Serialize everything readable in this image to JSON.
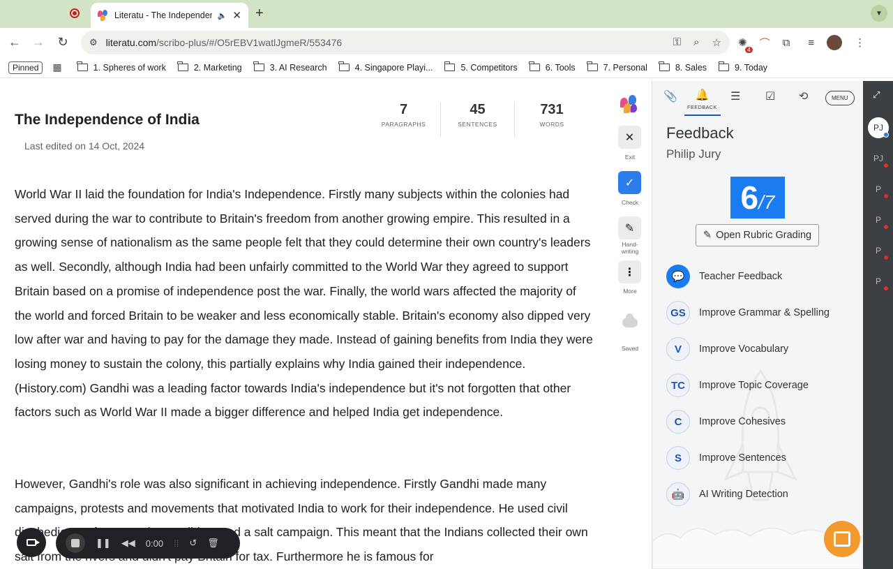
{
  "browser": {
    "tab_title": "Literatu - The Independen",
    "url_host": "literatu.com",
    "url_path": "/scribo-plus/#/O5rEBV1watlJgmeR/553476",
    "extension_badge": "4",
    "pinned_label": "Pinned",
    "bookmarks": [
      "1. Spheres of work",
      "2. Marketing",
      "3. AI Research",
      "4. Singapore Playi...",
      "5. Competitors",
      "6. Tools",
      "7. Personal",
      "8. Sales",
      "9. Today"
    ]
  },
  "document": {
    "title": "The Independence of India",
    "last_edited": "Last edited on 14 Oct, 2024",
    "stats": [
      {
        "value": "7",
        "label": "PARAGRAPHS"
      },
      {
        "value": "45",
        "label": "SENTENCES"
      },
      {
        "value": "731",
        "label": "WORDS"
      }
    ],
    "paragraph_1": "World War II laid the foundation for India's Independence. Firstly many subjects within the colonies had served during the war to contribute to Britain's freedom from another growing empire. This resulted in a growing sense of nationalism as the same people felt that they could determine their own country's leaders as well. Secondly, although India had been unfairly committed to the World War they agreed to support Britain based on a promise of independence post the war. Finally, the world wars affected the majority of the world and forced Britain to be weaker and less economically stable. Britain's economy also dipped very low after war and having to pay for the damage they made. Instead of gaining benefits from India they were losing money to sustain the colony, this partially explains why India gained their independence.(History.com) Gandhi was a leading factor towards India's independence but it's not forgotten that other factors such as World War II made a bigger difference and helped India get independence.",
    "paragraph_2": "However,  Gandhi's role was also significant in achieving independence. Firstly Gandhi made many campaigns, protests and movements that motivated India to work for their independence. He used civil disobedience, for example Gandhi started a salt campaign. This meant that the Indians collected their own salt from the rivers and didn't pay Britain for tax. Furthermore he is famous for"
  },
  "tools": {
    "exit": "Exit",
    "check": "Check",
    "handwriting": "Hand-\nwriting",
    "more": "More",
    "saved": "Saved"
  },
  "panel": {
    "tab_feedback_label": "FEEDBACK",
    "menu_label": "MENU",
    "heading": "Feedback",
    "student_name": "Philip Jury",
    "score": "6",
    "score_max": "/7",
    "rubric_button": "Open Rubric Grading",
    "items": [
      {
        "badge": "",
        "label": "Teacher Feedback"
      },
      {
        "badge": "GS",
        "label": "Improve Grammar & Spelling"
      },
      {
        "badge": "V",
        "label": "Improve Vocabulary"
      },
      {
        "badge": "TC",
        "label": "Improve Topic Coverage"
      },
      {
        "badge": "C",
        "label": "Improve Cohesives"
      },
      {
        "badge": "S",
        "label": "Improve Sentences"
      },
      {
        "badge": "",
        "label": "AI Writing Detection"
      }
    ]
  },
  "rail": {
    "avatars": [
      "PJ",
      "PJ",
      "P",
      "P",
      "P",
      "P"
    ]
  },
  "recorder": {
    "time": "0:00"
  },
  "colors": {
    "accent": "#1a7cf0",
    "chat_button": "#f39a2e",
    "rail_bg": "#3c4043"
  }
}
